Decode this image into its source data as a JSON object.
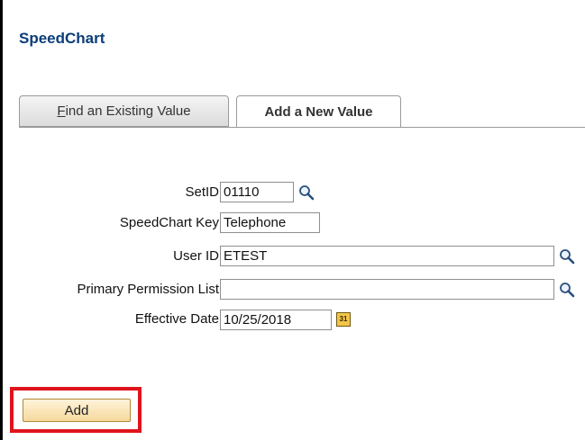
{
  "page": {
    "title": "SpeedChart"
  },
  "tabs": [
    {
      "label_accesskey": "F",
      "label_rest": "ind an Existing Value",
      "active": false
    },
    {
      "label": "Add a New Value",
      "active": true
    }
  ],
  "form": {
    "setid": {
      "label": "SetID",
      "value": "01110"
    },
    "speedchart_key": {
      "label": "SpeedChart Key",
      "value": "Telephone"
    },
    "user_id": {
      "label": "User ID",
      "value": "ETEST"
    },
    "primary_permission_list": {
      "label": "Primary Permission List",
      "value": ""
    },
    "effective_date": {
      "label": "Effective Date",
      "value": "10/25/2018",
      "calendar_icon_text": "31"
    }
  },
  "actions": {
    "add_label": "Add"
  },
  "icons": {
    "lookup": "magnifier-lookup-icon",
    "calendar": "calendar-icon"
  },
  "colors": {
    "title": "#0b3d78",
    "highlight": "#e0141c"
  }
}
